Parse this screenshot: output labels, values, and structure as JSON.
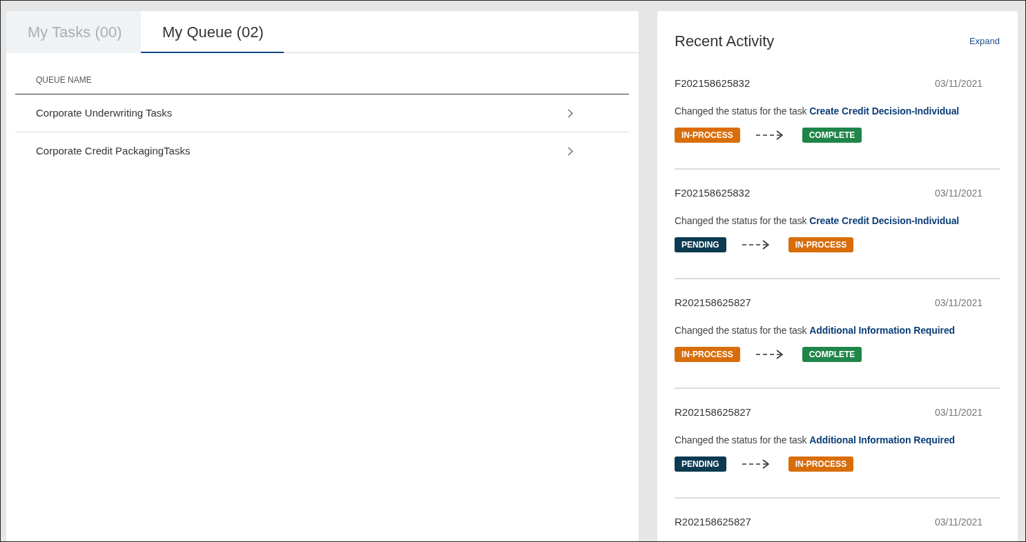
{
  "tabs": [
    {
      "label": "My Tasks (00)",
      "selected": false
    },
    {
      "label": "My Queue (02)",
      "selected": true
    }
  ],
  "queue_table": {
    "columns": [
      "QUEUE NAME"
    ],
    "rows": [
      {
        "name": "Corporate Underwriting Tasks"
      },
      {
        "name": "Corporate Credit PackagingTasks"
      }
    ]
  },
  "recent_activity": {
    "title": "Recent Activity",
    "expand_link": "Expand",
    "items": [
      {
        "id": "F202158625832",
        "date": "03/11/2021",
        "text": "Changed the status for the task",
        "task": "Create Credit Decision-Individual",
        "from": {
          "label": "IN-PROCESS",
          "color": "#d96d0a"
        },
        "to": {
          "label": "COMPLETE",
          "color": "#1f8549"
        }
      },
      {
        "id": "F202158625832",
        "date": "03/11/2021",
        "text": "Changed the status for the task",
        "task": "Create Credit Decision-Individual",
        "from": {
          "label": "PENDING",
          "color": "#0c3a51"
        },
        "to": {
          "label": "IN-PROCESS",
          "color": "#d96d0a"
        }
      },
      {
        "id": "R202158625827",
        "date": "03/11/2021",
        "text": "Changed the status for the task",
        "task": "Additional Information Required",
        "from": {
          "label": "IN-PROCESS",
          "color": "#d96d0a"
        },
        "to": {
          "label": "COMPLETE",
          "color": "#1f8549"
        }
      },
      {
        "id": "R202158625827",
        "date": "03/11/2021",
        "text": "Changed the status for the task",
        "task": "Additional Information Required",
        "from": {
          "label": "PENDING",
          "color": "#0c3a51"
        },
        "to": {
          "label": "IN-PROCESS",
          "color": "#d96d0a"
        }
      },
      {
        "id": "R202158625827",
        "date": "03/11/2021"
      }
    ]
  }
}
